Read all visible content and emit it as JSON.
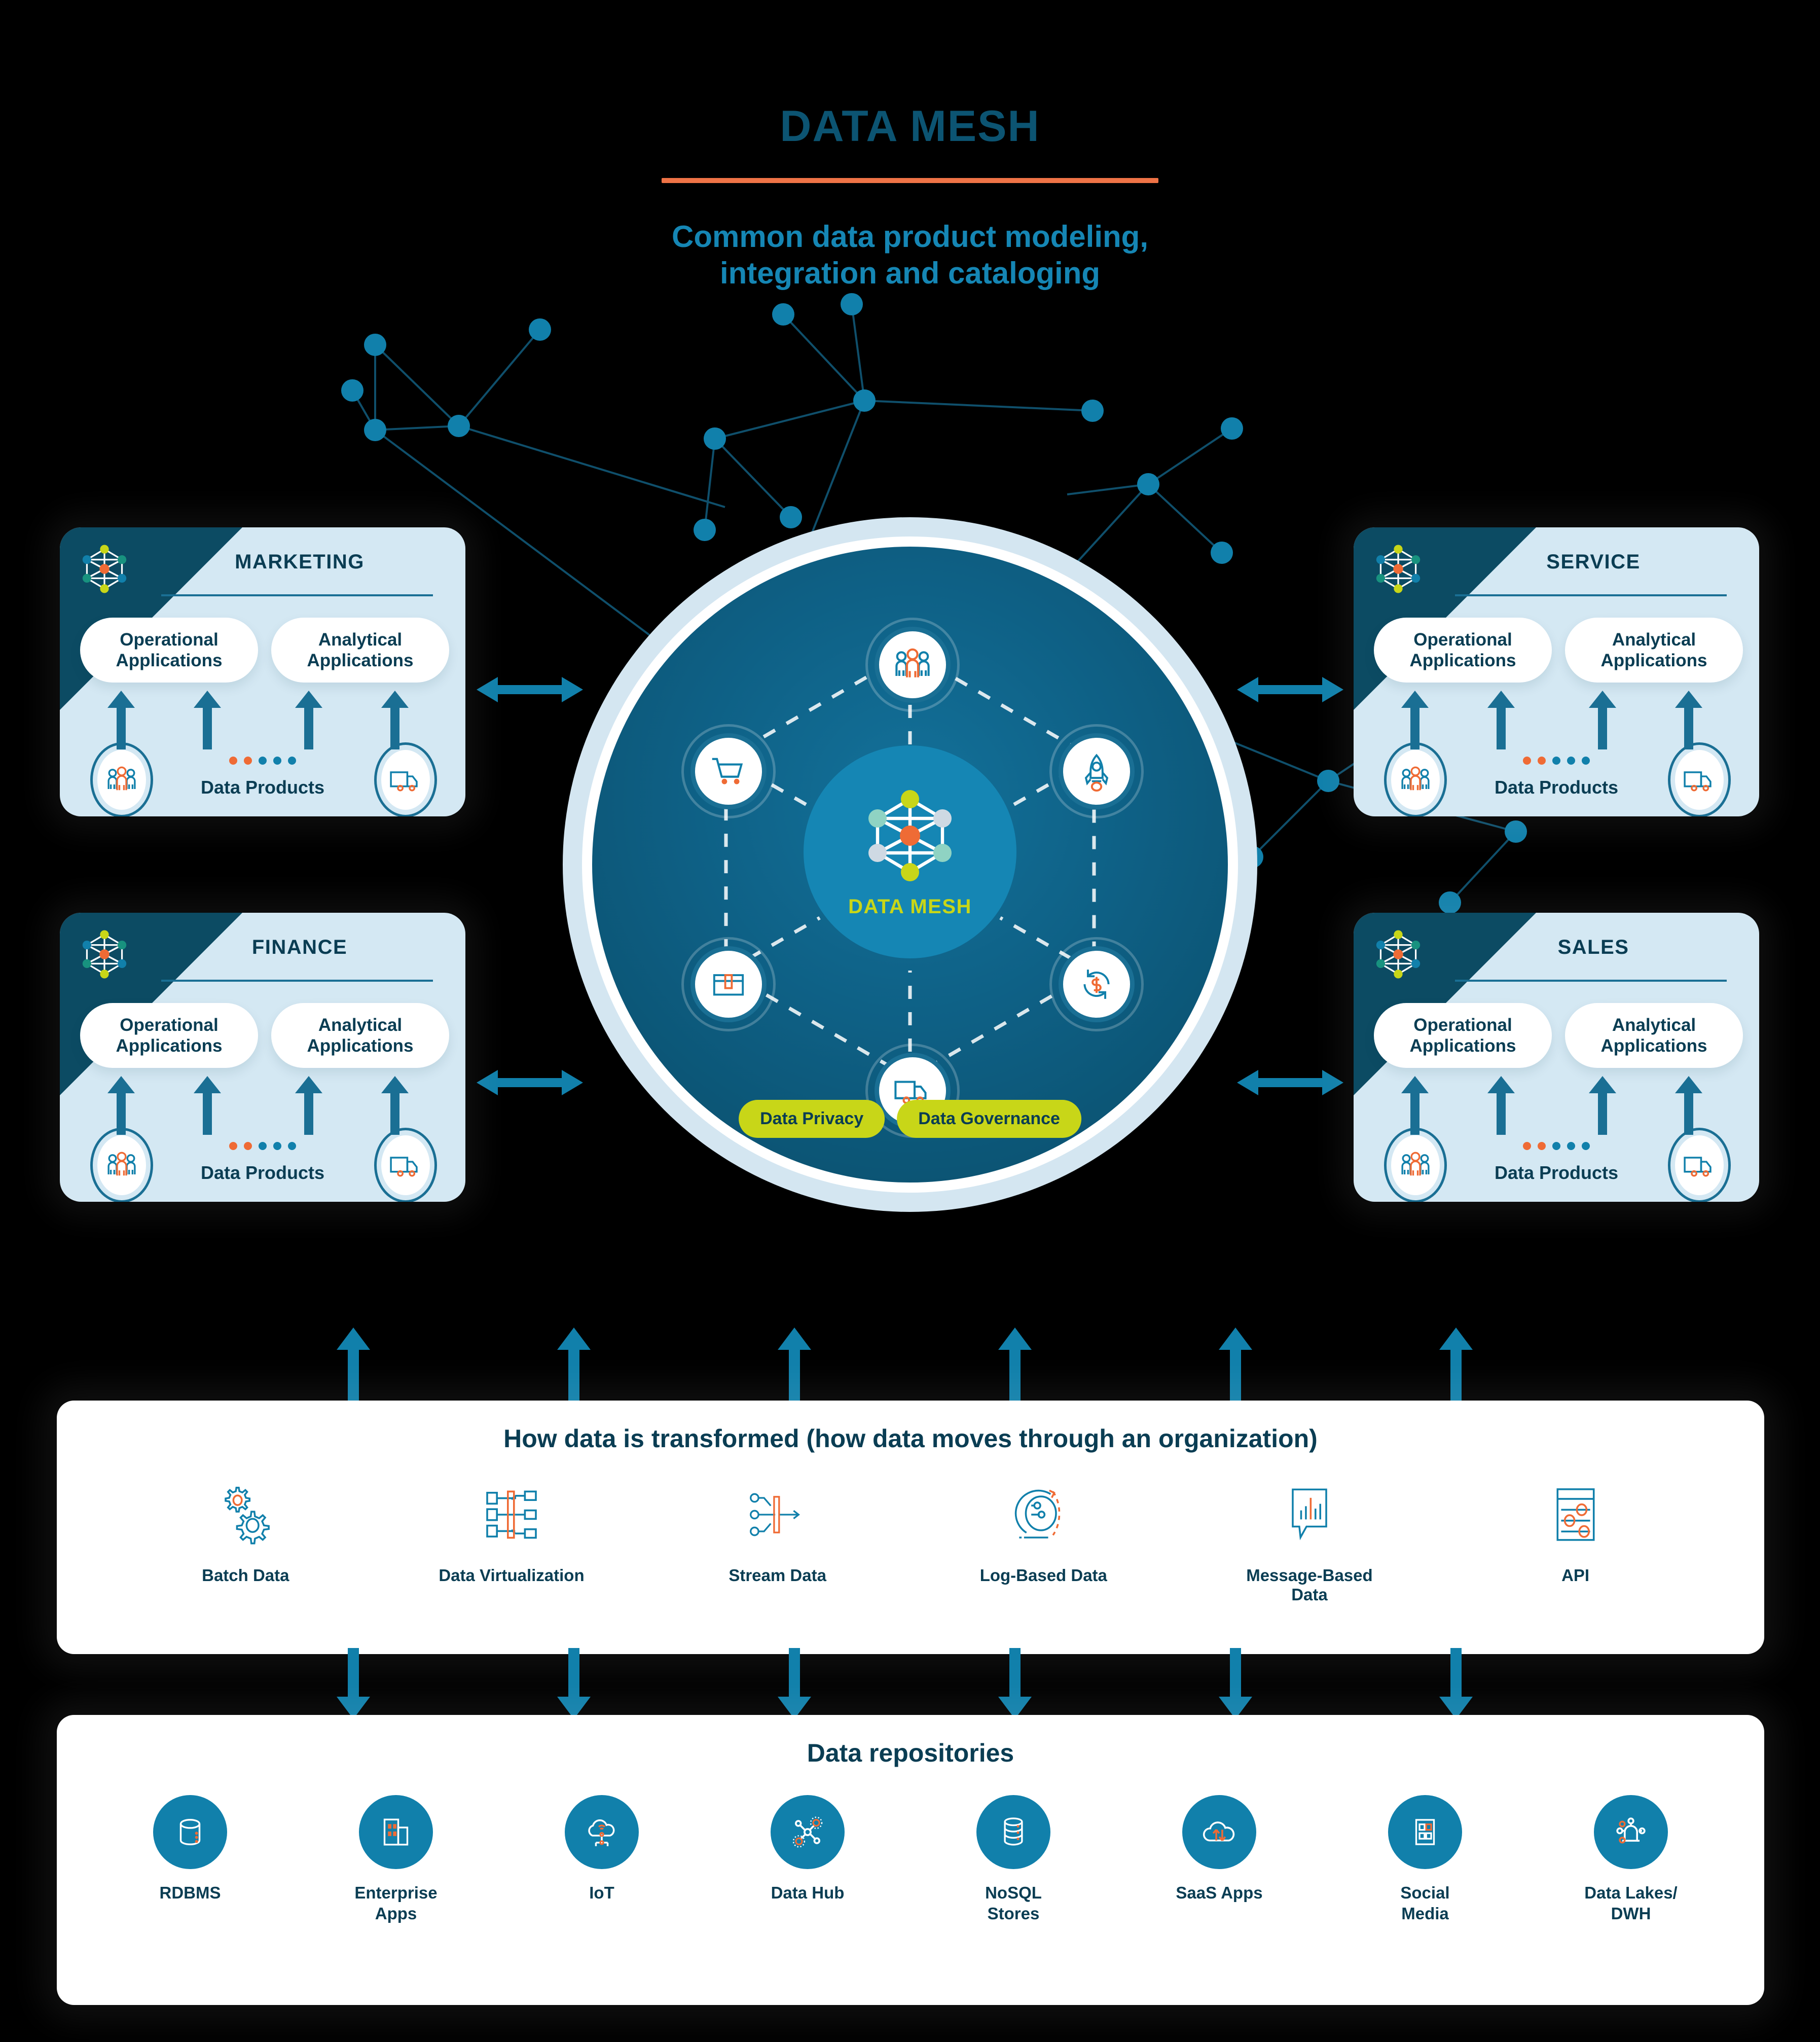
{
  "header": {
    "title": "DATA MESH",
    "subtitle": "Common data product modeling,\nintegration and cataloging",
    "subtitle_line1": "Common data product modeling,",
    "subtitle_line2": "integration and cataloging"
  },
  "colors": {
    "background": "#000000",
    "title_teal": "#0c5472",
    "accent_orange": "#ef7346",
    "subtitle_blue": "#1586b4",
    "panel_bg": "#d4e8f3",
    "panel_corner": "#0c4b63",
    "deep_teal": "#0a3d53",
    "circle_core": "#0e6085",
    "circle_inner": "#1586b4",
    "ring_light": "#d4e6f1",
    "lime": "#c8d618",
    "node_blue": "#1180ab"
  },
  "center": {
    "label": "DATA MESH",
    "governance_pills": [
      {
        "label": "Data Privacy"
      },
      {
        "label": "Data Governance"
      }
    ],
    "orbit_icons": [
      {
        "name": "people-icon",
        "position": "top"
      },
      {
        "name": "rocket-icon",
        "position": "top-right"
      },
      {
        "name": "refresh-dollar-icon",
        "position": "bottom-right"
      },
      {
        "name": "delivery-truck-icon",
        "position": "bottom"
      },
      {
        "name": "archive-box-icon",
        "position": "bottom-left"
      },
      {
        "name": "shopping-cart-icon",
        "position": "top-left"
      }
    ],
    "mesh_node_colors": [
      "#c8d618",
      "#8fd3c3",
      "#ced9e3",
      "#ef6b35",
      "#ced9e3",
      "#8fd3c3",
      "#c8d618"
    ]
  },
  "panels": [
    {
      "id": "marketing",
      "title": "MARKETING",
      "operational": "Operational\nApplications",
      "operational_line1": "Operational",
      "operational_line2": "Applications",
      "analytical": "Analytical\nApplications",
      "analytical_line1": "Analytical",
      "analytical_line2": "Applications",
      "data_products_label": "Data Products",
      "left_icon": "people-icon",
      "right_icon": "delivery-truck-icon",
      "dot_colors": [
        "#ef6b35",
        "#ef6b35",
        "#1180ab",
        "#1180ab",
        "#1180ab"
      ]
    },
    {
      "id": "finance",
      "title": "FINANCE",
      "operational_line1": "Operational",
      "operational_line2": "Applications",
      "analytical_line1": "Analytical",
      "analytical_line2": "Applications",
      "data_products_label": "Data Products",
      "left_icon": "people-icon",
      "right_icon": "delivery-truck-icon",
      "dot_colors": [
        "#ef6b35",
        "#ef6b35",
        "#1180ab",
        "#1180ab",
        "#1180ab"
      ]
    },
    {
      "id": "service",
      "title": "SERVICE",
      "operational_line1": "Operational",
      "operational_line2": "Applications",
      "analytical_line1": "Analytical",
      "analytical_line2": "Applications",
      "data_products_label": "Data Products",
      "left_icon": "people-icon",
      "right_icon": "delivery-truck-icon",
      "dot_colors": [
        "#ef6b35",
        "#ef6b35",
        "#1180ab",
        "#1180ab",
        "#1180ab"
      ]
    },
    {
      "id": "sales",
      "title": "SALES",
      "operational_line1": "Operational",
      "operational_line2": "Applications",
      "analytical_line1": "Analytical",
      "analytical_line2": "Applications",
      "data_products_label": "Data Products",
      "left_icon": "people-icon",
      "right_icon": "delivery-truck-icon",
      "dot_colors": [
        "#ef6b35",
        "#ef6b35",
        "#1180ab",
        "#1180ab",
        "#1180ab"
      ]
    }
  ],
  "transform": {
    "title": "How data is transformed (how data moves through an organization)",
    "items": [
      {
        "label": "Batch Data",
        "icon": "gears-icon"
      },
      {
        "label": "Data Virtualization",
        "icon": "virtualization-tree-icon"
      },
      {
        "label": "Stream Data",
        "icon": "stream-arrow-icon"
      },
      {
        "label": "Log-Based Data",
        "icon": "log-disc-icon"
      },
      {
        "label": "Message-Based Data",
        "icon": "message-chart-icon"
      },
      {
        "label": "API",
        "icon": "api-sliders-icon"
      }
    ]
  },
  "repositories": {
    "title": "Data repositories",
    "items": [
      {
        "label": "RDBMS",
        "icon": "database-cylinder-icon"
      },
      {
        "label": "Enterprise\nApps",
        "line1": "Enterprise",
        "line2": "Apps",
        "icon": "buildings-icon"
      },
      {
        "label": "IoT",
        "line1": "IoT",
        "line2": "",
        "icon": "iot-cloud-icon"
      },
      {
        "label": "Data Hub",
        "line1": "Data Hub",
        "line2": "",
        "icon": "hub-network-icon"
      },
      {
        "label": "NoSQL\nStores",
        "line1": "NoSQL",
        "line2": "Stores",
        "icon": "database-stack-icon"
      },
      {
        "label": "SaaS Apps",
        "line1": "SaaS Apps",
        "line2": "",
        "icon": "cloud-sync-icon"
      },
      {
        "label": "Social\nMedia",
        "line1": "Social",
        "line2": "Media",
        "icon": "social-grid-icon"
      },
      {
        "label": "Data Lakes/\nDWH",
        "line1": "Data Lakes/",
        "line2": "DWH",
        "icon": "data-lake-network-icon"
      }
    ]
  }
}
